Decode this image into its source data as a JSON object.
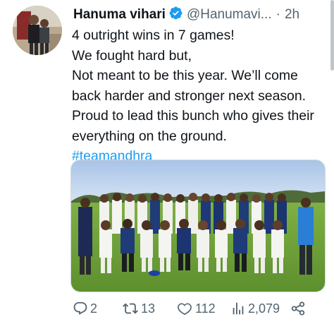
{
  "author": {
    "name": "Hanuma vihari",
    "handle": "@Hanumavi...",
    "separator": "·",
    "time": "2h",
    "verified_icon": "verified-badge-icon",
    "verified_color": "#1d9bf0"
  },
  "tweet": {
    "lines": [
      "4 outright wins in 7 games!",
      "We fought hard but,",
      "Not meant to be this year. We’ll come",
      "back harder and stronger next season.",
      "Proud to lead this bunch who gives their",
      "everything on the ground."
    ],
    "hashtag": "#teamandhra",
    "hashtag_color": "#1d9bf0"
  },
  "media": {
    "icon": "team-photo-image"
  },
  "actions": {
    "replies": "2",
    "retweets": "13",
    "likes": "112",
    "views": "2,079",
    "icons": [
      "reply-icon",
      "retweet-icon",
      "like-icon",
      "views-icon",
      "share-icon"
    ]
  }
}
